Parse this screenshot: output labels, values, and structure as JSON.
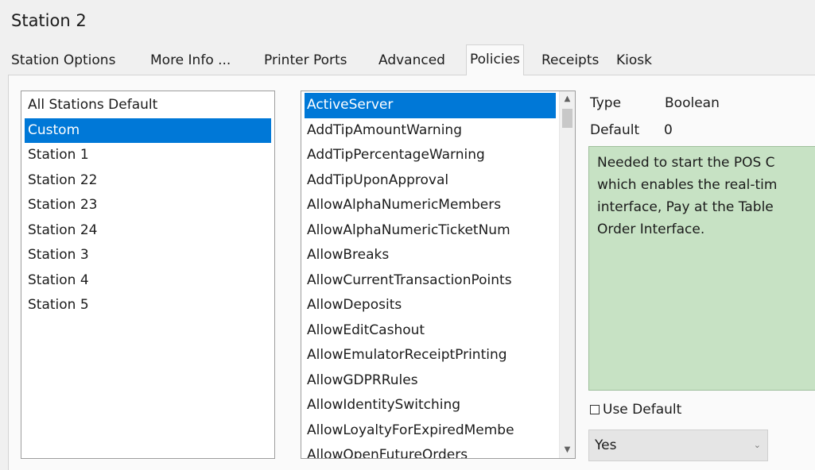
{
  "window": {
    "title": "Station 2"
  },
  "tabs": [
    {
      "label": "Station Options"
    },
    {
      "label": "More Info ..."
    },
    {
      "label": "Printer Ports"
    },
    {
      "label": "Advanced"
    },
    {
      "label": "Policies"
    },
    {
      "label": "Receipts"
    },
    {
      "label": "Kiosk"
    }
  ],
  "active_tab": "Policies",
  "stations": {
    "items": [
      "All Stations Default",
      "Custom",
      "Station 1",
      "Station 22",
      "Station 23",
      "Station 24",
      "Station 3",
      "Station 4",
      "Station 5"
    ],
    "selected": "Custom"
  },
  "policies": {
    "items": [
      "ActiveServer",
      "AddTipAmountWarning",
      "AddTipPercentageWarning",
      "AddTipUponApproval",
      "AllowAlphaNumericMembers",
      "AllowAlphaNumericTicketNum",
      "AllowBreaks",
      "AllowCurrentTransactionPoints",
      "AllowDeposits",
      "AllowEditCashout",
      "AllowEmulatorReceiptPrinting",
      "AllowGDPRRules",
      "AllowIdentitySwitching",
      "AllowLoyaltyForExpiredMembe",
      "AllowOpenFutureOrders"
    ],
    "selected": "ActiveServer"
  },
  "details": {
    "type_label": "Type",
    "type_value": "Boolean",
    "default_label": "Default",
    "default_value": "0",
    "description": "Needed to start the POS C\nwhich enables the real-tim\ninterface, Pay at the Table\nOrder Interface.",
    "use_default_label": "Use Default",
    "use_default_checked": false,
    "value_select": "Yes"
  },
  "colors": {
    "selection": "#0078d7",
    "description_bg": "#c7e2c4"
  }
}
